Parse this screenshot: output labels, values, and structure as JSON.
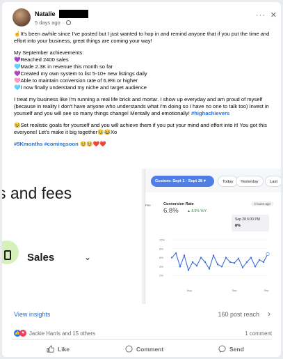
{
  "post": {
    "author": "Natalie",
    "timestamp": "5 days ago",
    "menu": "···",
    "close": "✕",
    "intro": "☝️It's been awhile since I've posted but I just wanted to hop in and remind anyone that if you put the time and effort into your business, great things are coming your way!",
    "achievements_title": "My September achievements:",
    "achievements": [
      "💜Reached 2400 sales",
      "🩵Made 2.3K in revenue this month so far",
      "💜Created my own system to list 5-10+ new listings daily",
      "🩷Able to maintain conversion rate of 6.8% or higher",
      "🩵I now finally understand my niche and target audience"
    ],
    "paragraph3": "I treat my business like I'm running a real life brick and mortar. I show up everyday and am proud of myself (because in reality I don't have anyone who understands what I'm doing so I have no one to talk too) Invest in yourself and you will see so many things change! Mentally and emotionally!",
    "paragraph3_tag": "#highachievers",
    "paragraph4": "🥹Set realistic goals for yourself and you will achieve them if you put your mind and effort into it! You got this everyone! Let's make it big together🥹😂Xo",
    "hashtags": "#5Kmonths #comingsoon",
    "hashtag_emojis": "🥹🥹❤️❤️"
  },
  "media": {
    "left_text": "s and fees",
    "left_sales": "Sales",
    "date_range_pill": "Custom: Sept 1 - Sept 28 ▾",
    "today_pill": "Today",
    "yesterday_pill": "Yesterday",
    "last_pill": "Last",
    "edge_label": "Fee",
    "conversion_title": "Conversion Rate",
    "conversion_value": "6.8%",
    "yoy": "▲ 8.5% YoY",
    "hours_ago": "4 hours ago",
    "tooltip_date": "Sep 28 6:00 PM",
    "tooltip_value": "8%",
    "y_ticks": [
      "10%",
      "8%",
      "6%",
      "4%",
      "2%"
    ],
    "x_ticks": [
      "Aug",
      "Sep",
      "Sep"
    ]
  },
  "footer": {
    "view_insights": "View insights",
    "post_reach": "160 post reach",
    "reactors": "Jackie Harris and 15 others",
    "comment_count": "1 comment",
    "like": "Like",
    "comment": "Comment",
    "send": "Send"
  },
  "chart_data": {
    "type": "line",
    "title": "Conversion Rate",
    "values": [
      6,
      7,
      4,
      6.5,
      3.2,
      5,
      4.2,
      6,
      5,
      3.5,
      6.5,
      4.5,
      4,
      6,
      5,
      4.8,
      5.8,
      3.8,
      5,
      6,
      4,
      5.5,
      5,
      6.8
    ],
    "ylim": [
      0,
      10
    ]
  },
  "colors": {
    "accent": "#216fdb",
    "pill": "#4f7fe6"
  }
}
